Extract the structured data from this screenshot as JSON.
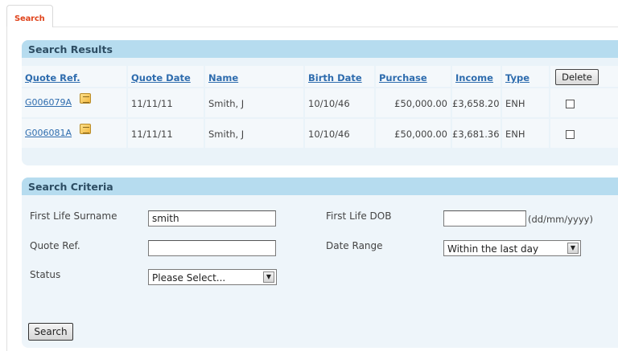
{
  "tab": {
    "label": "Search"
  },
  "results": {
    "title": "Search Results",
    "columns": {
      "quote_ref": "Quote Ref.",
      "quote_date": "Quote Date",
      "name": "Name",
      "birth_date": "Birth Date",
      "purchase": "Purchase",
      "income": "Income",
      "type": "Type"
    },
    "delete_label": "Delete",
    "rows": [
      {
        "quote_ref": "G006079A",
        "quote_date": "11/11/11",
        "name": "Smith, J",
        "birth_date": "10/10/46",
        "purchase": "£50,000.00",
        "income": "£3,658.20",
        "type": "ENH",
        "selected": false
      },
      {
        "quote_ref": "G006081A",
        "quote_date": "11/11/11",
        "name": "Smith, J",
        "birth_date": "10/10/46",
        "purchase": "£50,000.00",
        "income": "£3,681.36",
        "type": "ENH",
        "selected": false
      }
    ]
  },
  "criteria": {
    "title": "Search Criteria",
    "surname_label": "First Life Surname",
    "surname_value": "smith",
    "quote_ref_label": "Quote Ref.",
    "quote_ref_value": "",
    "status_label": "Status",
    "status_selected": "Please Select...",
    "dob_label": "First Life DOB",
    "dob_value": "",
    "dob_hint": "(dd/mm/yyyy)",
    "date_range_label": "Date Range",
    "date_range_selected": "Within the last day",
    "search_label": "Search"
  },
  "icons": {
    "row_note": "note-icon",
    "dropdown": "dropdown-arrow-icon"
  }
}
